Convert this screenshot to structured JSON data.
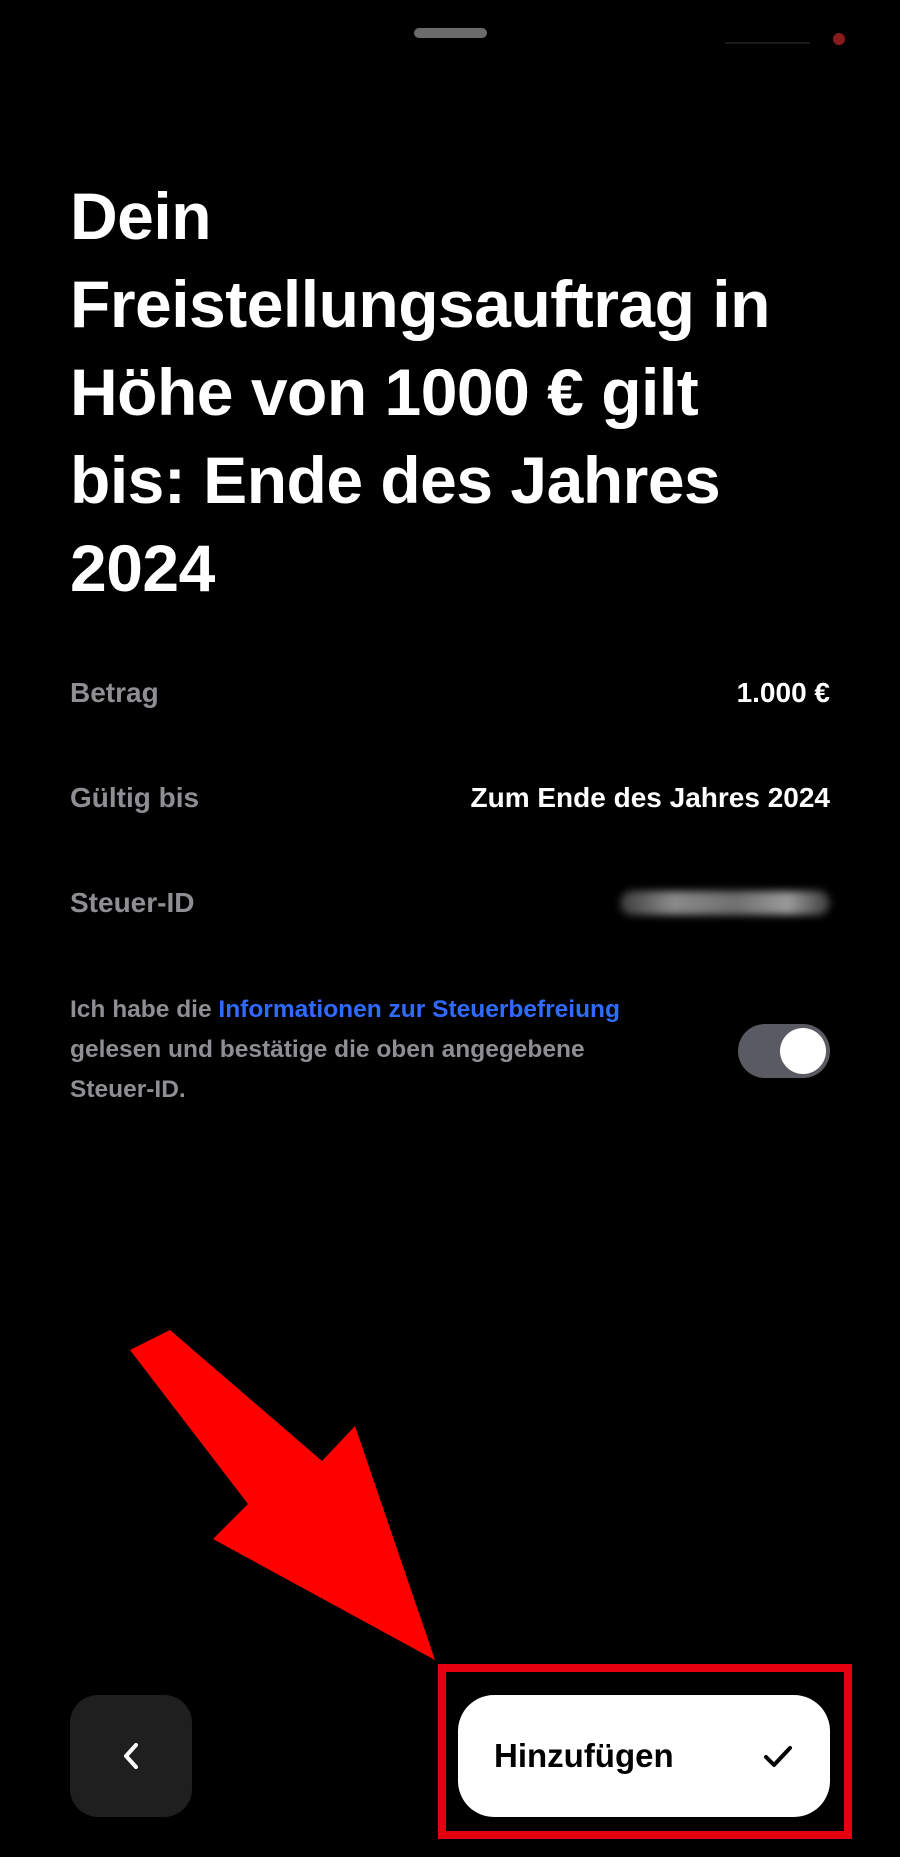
{
  "header": {
    "title": "Dein Freistellungsauftrag in Höhe von 1000 € gilt bis: Ende des Jahres 2024"
  },
  "details": {
    "amount_label": "Betrag",
    "amount_value": "1.000 €",
    "valid_label": "Gültig bis",
    "valid_value": "Zum Ende des Jahres 2024",
    "taxid_label": "Steuer-ID"
  },
  "consent": {
    "prefix": "Ich habe die ",
    "link": "Informationen zur Steuerbefreiung",
    "suffix": " gelesen und bestätige die oben angegebene Steuer-ID.",
    "toggle_on": true
  },
  "footer": {
    "back_icon": "chevron-left-icon",
    "add_label": "Hinzufügen",
    "add_icon": "checkmark-icon"
  },
  "annotation": {
    "arrow_color": "#ff0000",
    "box_color": "#e6000f"
  },
  "colors": {
    "background": "#000000",
    "muted_text": "#8e8e93",
    "link": "#2f6bff",
    "toggle_track": "#5a5b62"
  }
}
